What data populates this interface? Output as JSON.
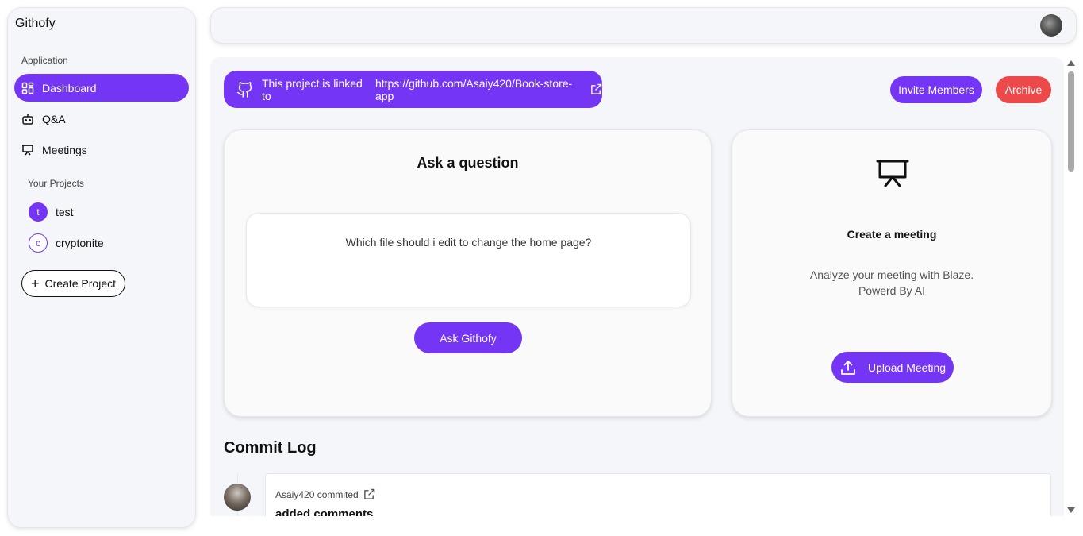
{
  "sidebar": {
    "brand": "Githofy",
    "application_label": "Application",
    "nav": [
      {
        "label": "Dashboard",
        "icon": "dashboard-icon",
        "active": true
      },
      {
        "label": "Q&A",
        "icon": "bot-icon",
        "active": false
      },
      {
        "label": "Meetings",
        "icon": "presentation-icon",
        "active": false
      }
    ],
    "projects_label": "Your Projects",
    "projects": [
      {
        "initial": "t",
        "name": "test",
        "selected": true
      },
      {
        "initial": "c",
        "name": "cryptonite",
        "selected": false
      }
    ],
    "create_project_label": "Create Project"
  },
  "linked": {
    "prefix": "This project is linked to",
    "url": "https://github.com/Asaiy420/Book-store-app"
  },
  "actions": {
    "invite_label": "Invite Members",
    "archive_label": "Archive"
  },
  "ask": {
    "title": "Ask a question",
    "question_value": "Which file should i edit to change the home page?",
    "button_label": "Ask Githofy"
  },
  "meeting": {
    "title": "Create a meeting",
    "desc_line1": "Analyze your meeting with Blaze.",
    "desc_line2": "Powerd By AI",
    "upload_label": "Upload Meeting"
  },
  "commits": {
    "title": "Commit Log",
    "items": [
      {
        "author_text": "Asaiy420 commited",
        "message": "added comments"
      }
    ]
  },
  "colors": {
    "accent": "#7436f4",
    "danger": "#ec4a4a",
    "panel": "#f4f6f9"
  }
}
